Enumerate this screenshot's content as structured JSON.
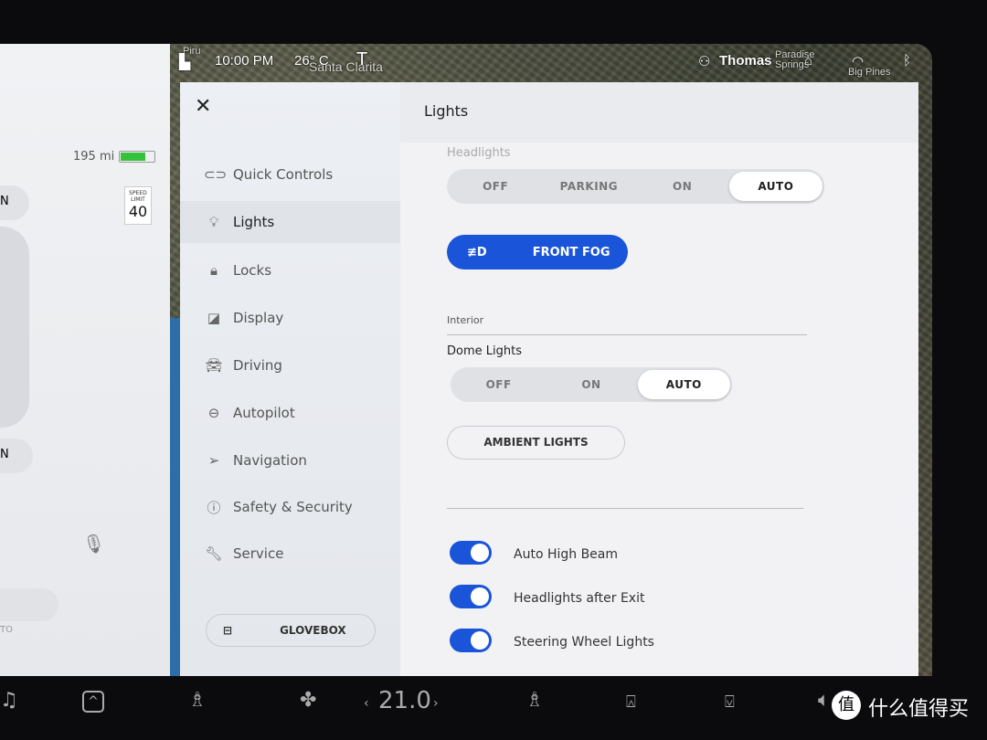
{
  "status_bar": {
    "time": "10:00 PM",
    "temperature": "26° C",
    "user": "Thomas",
    "map_labels": [
      "Piru",
      "Santa Clarita",
      "Paradise Springs",
      "Big Pines"
    ]
  },
  "car_panel": {
    "range": "195 mi",
    "battery_level": 0.75,
    "speed_limit_label": "SPEED LIMIT",
    "speed_limit": "40",
    "partial_labels": [
      "N",
      "N",
      "TO"
    ]
  },
  "settings": {
    "close_icon": "close-icon",
    "nav": [
      {
        "label": "Quick Controls",
        "icon": "toggle-icon"
      },
      {
        "label": "Lights",
        "icon": "bulb-icon",
        "selected": true
      },
      {
        "label": "Locks",
        "icon": "lock-icon"
      },
      {
        "label": "Display",
        "icon": "display-icon"
      },
      {
        "label": "Driving",
        "icon": "car-icon"
      },
      {
        "label": "Autopilot",
        "icon": "steering-wheel-icon"
      },
      {
        "label": "Navigation",
        "icon": "navigation-icon"
      },
      {
        "label": "Safety & Security",
        "icon": "alert-icon"
      },
      {
        "label": "Service",
        "icon": "wrench-icon"
      }
    ],
    "glovebox": "GLOVEBOX",
    "title": "Lights",
    "headlights": {
      "label": "Headlights",
      "options": [
        "OFF",
        "PARKING",
        "ON",
        "AUTO"
      ],
      "selected": "AUTO"
    },
    "front_fog": "FRONT FOG",
    "interior_label": "Interior",
    "dome": {
      "label": "Dome Lights",
      "options": [
        "OFF",
        "ON",
        "AUTO"
      ],
      "selected": "AUTO"
    },
    "ambient": "AMBIENT LIGHTS",
    "toggles": [
      {
        "label": "Auto High Beam",
        "on": true
      },
      {
        "label": "Headlights after Exit",
        "on": true
      },
      {
        "label": "Steering Wheel Lights",
        "on": true
      }
    ]
  },
  "bottom_bar": {
    "temperature": "21.0",
    "watermark": "什么值得买",
    "colors": {
      "accent": "#1a55d9"
    }
  }
}
